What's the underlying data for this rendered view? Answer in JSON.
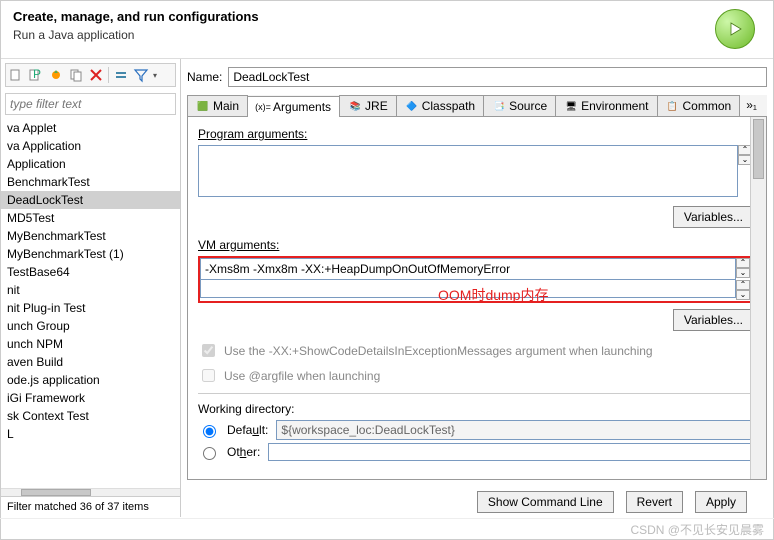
{
  "header": {
    "title": "Create, manage, and run configurations",
    "subtitle": "Run a Java application"
  },
  "filter": {
    "placeholder": "type filter text"
  },
  "tree": {
    "items": [
      "va Applet",
      "va Application",
      "Application",
      "BenchmarkTest",
      "DeadLockTest",
      "MD5Test",
      "MyBenchmarkTest",
      "MyBenchmarkTest (1)",
      "TestBase64",
      "nit",
      "nit Plug-in Test",
      "unch Group",
      "unch NPM",
      "aven Build",
      "ode.js application",
      "iGi Framework",
      "sk Context Test",
      "L"
    ],
    "selected_index": 4,
    "footer": "Filter matched 36 of 37 items"
  },
  "form": {
    "name_label": "Name:",
    "name_value": "DeadLockTest"
  },
  "tabs": {
    "items": [
      "Main",
      "Arguments",
      "JRE",
      "Classpath",
      "Source",
      "Environment",
      "Common"
    ],
    "active_index": 1,
    "overflow": "»₁"
  },
  "args": {
    "program_label": "Program arguments:",
    "program_value": "",
    "variables_btn": "Variables...",
    "vm_label": "VM arguments:",
    "vm_value": "-Xms8m -Xmx8m -XX:+HeapDumpOnOutOfMemoryError",
    "annotation": "OOM时dump内存",
    "check1": "Use the -XX:+ShowCodeDetailsInExceptionMessages argument when launching",
    "check2": "Use @argfile when launching",
    "wd_label": "Working directory:",
    "default_label": "Default:",
    "default_value": "${workspace_loc:DeadLockTest}",
    "other_label": "Other:"
  },
  "buttons": {
    "show_cmd": "Show Command Line",
    "revert": "Revert",
    "apply": "Apply"
  },
  "watermark": "CSDN @不见长安见晨雾"
}
